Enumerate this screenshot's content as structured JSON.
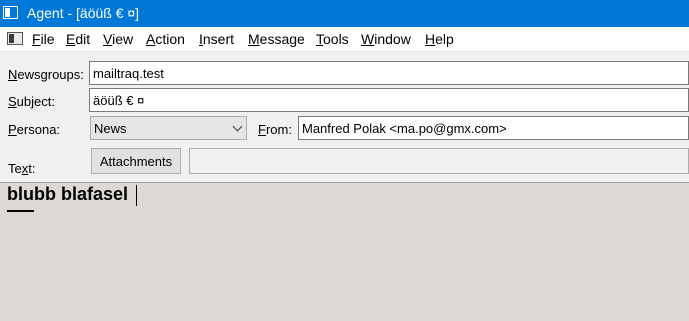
{
  "window": {
    "title": "Agent - [äöüß  € ¤]"
  },
  "menubar": {
    "items": [
      {
        "acc": "F",
        "rest": "ile"
      },
      {
        "acc": "E",
        "rest": "dit"
      },
      {
        "acc": "V",
        "rest": "iew"
      },
      {
        "acc": "A",
        "rest": "ction"
      },
      {
        "acc": "I",
        "rest": "nsert"
      },
      {
        "acc": "M",
        "rest": "essage"
      },
      {
        "acc": "T",
        "rest": "ools"
      },
      {
        "acc": "W",
        "rest": "indow"
      },
      {
        "acc": "H",
        "rest": "elp"
      }
    ]
  },
  "form": {
    "newsgroups": {
      "label_acc": "N",
      "label_rest": "ewsgroups:",
      "value": "mailtraq.test"
    },
    "subject": {
      "label_acc": "S",
      "label_rest": "ubject:",
      "value": "äöüß  € ¤"
    },
    "persona": {
      "label_acc": "P",
      "label_rest": "ersona:",
      "selected": "News"
    },
    "from": {
      "label_acc": "F",
      "label_rest": "rom:",
      "value": "Manfred Polak <ma.po@gmx.com>"
    },
    "text": {
      "label_pre": "Te",
      "label_acc": "x",
      "label_post": "t:"
    },
    "attachments_label": "Attachments"
  },
  "editor": {
    "content": "blubb blafasel"
  }
}
